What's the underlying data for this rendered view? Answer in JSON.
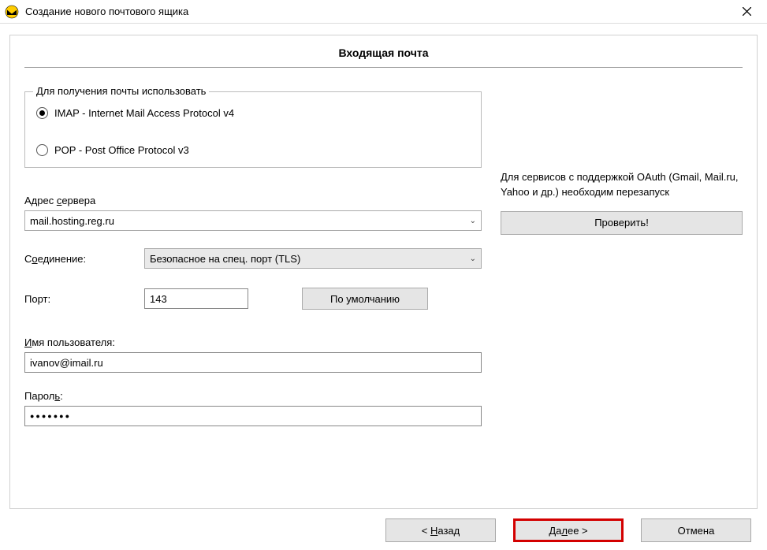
{
  "window": {
    "title": "Создание нового почтового ящика"
  },
  "heading": "Входящая почта",
  "protocol_group": {
    "legend": "Для получения почты использовать",
    "imap_label": "IMAP - Internet Mail Access Protocol v4",
    "pop_label": "POP  -  Post Office Protocol v3",
    "selected": "imap"
  },
  "server_address": {
    "label_pre": "Адрес ",
    "label_u": "с",
    "label_post": "ервера",
    "value": "mail.hosting.reg.ru"
  },
  "connection": {
    "label_pre": "С",
    "label_u": "о",
    "label_post": "единение:",
    "value": "Безопасное на спец. порт (TLS)"
  },
  "port": {
    "label": "Порт:",
    "value": "143",
    "default_btn": "По умолчанию"
  },
  "username": {
    "label_u": "И",
    "label_post": "мя пользователя:",
    "value": "ivanov@imail.ru"
  },
  "password": {
    "label_pre": "Парол",
    "label_u": "ь",
    "label_post": ":",
    "masked": "●●●●●●●"
  },
  "right": {
    "note": "Для сервисов с поддержкой OAuth (Gmail, Mail.ru, Yahoo и др.) необходим перезапуск",
    "check_btn": "Проверить!"
  },
  "footer": {
    "back_pre": "<   ",
    "back_u": "Н",
    "back_post": "азад",
    "next_pre": "Да",
    "next_u": "л",
    "next_post": "ее   >",
    "cancel": "Отмена"
  }
}
